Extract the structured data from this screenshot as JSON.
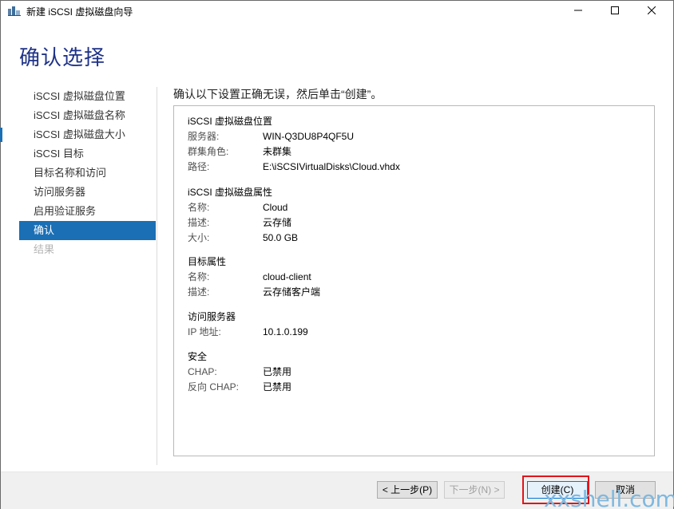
{
  "window": {
    "title": "新建 iSCSI 虚拟磁盘向导"
  },
  "header": {
    "title": "确认选择"
  },
  "nav": {
    "items": [
      {
        "label": "iSCSI 虚拟磁盘位置",
        "state": "normal"
      },
      {
        "label": "iSCSI 虚拟磁盘名称",
        "state": "normal"
      },
      {
        "label": "iSCSI 虚拟磁盘大小",
        "state": "normal"
      },
      {
        "label": "iSCSI 目标",
        "state": "normal"
      },
      {
        "label": "目标名称和访问",
        "state": "normal"
      },
      {
        "label": "访问服务器",
        "state": "normal"
      },
      {
        "label": "启用验证服务",
        "state": "normal"
      },
      {
        "label": "确认",
        "state": "active"
      },
      {
        "label": "结果",
        "state": "disabled"
      }
    ]
  },
  "main": {
    "instruction": "确认以下设置正确无误，然后单击“创建”。",
    "sections": [
      {
        "title": "iSCSI 虚拟磁盘位置",
        "rows": [
          {
            "key": "服务器:",
            "value": "WIN-Q3DU8P4QF5U"
          },
          {
            "key": "群集角色:",
            "value": "未群集"
          },
          {
            "key": "路径:",
            "value": "E:\\iSCSIVirtualDisks\\Cloud.vhdx"
          }
        ]
      },
      {
        "title": "iSCSI 虚拟磁盘属性",
        "rows": [
          {
            "key": "名称:",
            "value": "Cloud"
          },
          {
            "key": "描述:",
            "value": "云存储"
          },
          {
            "key": "大小:",
            "value": "50.0 GB"
          }
        ]
      },
      {
        "title": "目标属性",
        "rows": [
          {
            "key": "名称:",
            "value": "cloud-client"
          },
          {
            "key": "描述:",
            "value": "云存储客户端"
          }
        ]
      },
      {
        "title": "访问服务器",
        "rows": [
          {
            "key": "IP 地址:",
            "value": "10.1.0.199"
          }
        ]
      },
      {
        "title": "安全",
        "rows": [
          {
            "key": "CHAP:",
            "value": "已禁用"
          },
          {
            "key": "反向 CHAP:",
            "value": "已禁用"
          }
        ]
      }
    ]
  },
  "footer": {
    "prev_label": "< 上一步(P)",
    "next_label": "下一步(N) >",
    "create_label": "创建(C)",
    "cancel_label": "取消"
  },
  "watermark": "xxshell.com",
  "colors": {
    "accent": "#1a6fb5",
    "title_blue": "#1e3287",
    "highlight_red": "#e0151b"
  }
}
